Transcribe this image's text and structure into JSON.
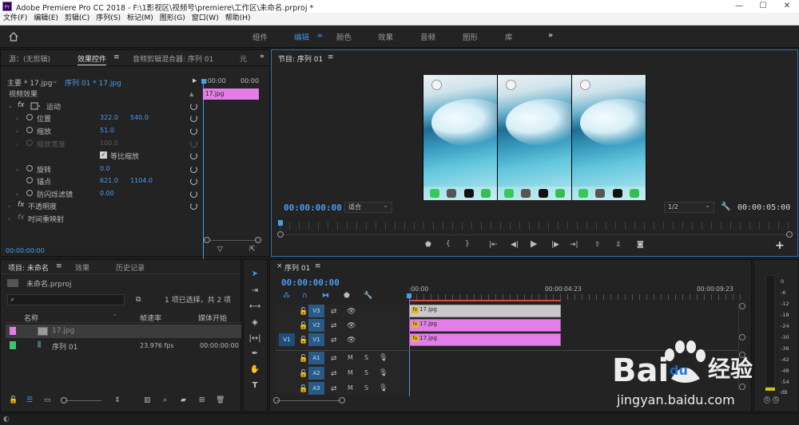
{
  "window": {
    "title": "Adobe Premiere Pro CC 2018 - F:\\1影视区\\视频号\\premiere\\工作区\\未命名.prproj *",
    "app_icon": "Pr",
    "minimize": "—",
    "maximize": "☐",
    "close": "✕"
  },
  "menu": [
    "文件(F)",
    "编辑(E)",
    "剪辑(C)",
    "序列(S)",
    "标记(M)",
    "图形(G)",
    "窗口(W)",
    "帮助(H)"
  ],
  "workspaces": {
    "home_icon": "home-icon",
    "items": [
      "组件",
      "编辑",
      "颜色",
      "效果",
      "音频",
      "图形",
      "库"
    ],
    "active": "编辑",
    "more": "»"
  },
  "effect_controls": {
    "tabs": [
      "源：(无剪辑)",
      "效果控件",
      "音频剪辑混合器: 序列 01",
      "元"
    ],
    "active_tab": "效果控件",
    "more": "»",
    "master": "主要 * 17.jpg",
    "clip": "序列 01 * 17.jpg",
    "ruler_start": ":00:00",
    "ruler_end": "00:00",
    "clip_bar": "17.jpg",
    "video_effects": "视频效果",
    "motion": "运动",
    "position_label": "位置",
    "position_x": "322.0",
    "position_y": "540.0",
    "scale_label": "缩放",
    "scale_value": "51.0",
    "scale_width_label": "缩放宽度",
    "scale_width_value": "100.0",
    "uniform_scale": "等比缩放",
    "rotation_label": "旋转",
    "rotation_value": "0.0",
    "anchor_label": "锚点",
    "anchor_x": "621.0",
    "anchor_y": "1104.0",
    "flicker_label": "防闪烁滤镜",
    "flicker_value": "0.00",
    "opacity": "不透明度",
    "time_remap": "时间重映射",
    "timecode": "00:00:00:00",
    "fx_symbol": "fx"
  },
  "program": {
    "title": "节目: 序列 01",
    "timecode": "00:00:00:00",
    "fit": "适合",
    "resolution": "1/2",
    "duration": "00:00:05:00",
    "add": "+"
  },
  "project": {
    "tabs": [
      "项目: 未命名",
      "效果",
      "历史记录"
    ],
    "active_tab": "项目: 未命名",
    "file": "未命名.prproj",
    "selection_status": "1 项已选择，共 2 项",
    "columns": [
      "名称",
      "帧速率",
      "媒体开始"
    ],
    "items": [
      {
        "name": "17.jpg",
        "fps": "",
        "start": "",
        "color": "#e37ee8"
      },
      {
        "name": "序列 01",
        "fps": "23.976 fps",
        "start": "00:00:00:00",
        "color": "#3fc46b"
      }
    ]
  },
  "timeline": {
    "title": "序列 01",
    "close": "×",
    "timecode": "00:00:00:00",
    "ruler": [
      ":00:00",
      "00:00:04:23",
      "00:00:09:23"
    ],
    "video_tracks": [
      "V3",
      "V2",
      "V1"
    ],
    "audio_tracks": [
      "A1",
      "A2",
      "A3"
    ],
    "source_patch_video": "V1",
    "mute": "M",
    "solo": "S",
    "clip_label": "17.jpg"
  },
  "meter": {
    "scale": [
      "0",
      "-6",
      "-12",
      "-18",
      "-24",
      "-30",
      "-36",
      "-42",
      "-48",
      "-54"
    ],
    "bottom": "dB",
    "solo_left": "S",
    "solo_right": "S"
  },
  "watermark": {
    "brand": "Bai",
    "brand_suffix": "du",
    "cn": "经验",
    "url": "jingyan.baidu.com"
  }
}
